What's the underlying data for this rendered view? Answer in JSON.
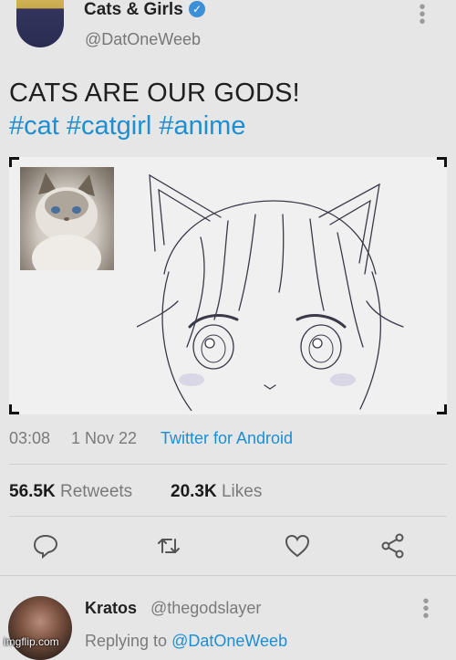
{
  "tweet": {
    "author_name": "Cats & Girls",
    "author_handle": "@DatOneWeeb",
    "text": "CATS ARE OUR GODS!",
    "hashtags": [
      "#cat",
      "#catgirl",
      "#anime"
    ],
    "time": "03:08",
    "date": "1 Nov 22",
    "source": "Twitter for Android",
    "retweets_count": "56.5K",
    "retweets_label": "Retweets",
    "likes_count": "20.3K",
    "likes_label": "Likes"
  },
  "icons": {
    "verified": "verified-badge-icon",
    "reply": "reply-icon",
    "retweet": "retweet-icon",
    "like": "heart-icon",
    "share": "share-icon",
    "more": "more-vertical-icon"
  },
  "reply": {
    "author_name": "Kratos",
    "author_handle": "@thegodslayer",
    "replying_prefix": "Replying to",
    "replying_to": "@DatOneWeeb"
  },
  "watermark": "imgflip.com",
  "colors": {
    "link": "#1d8ed2",
    "verified": "#3b8fd6",
    "background": "#e6e6e6"
  }
}
